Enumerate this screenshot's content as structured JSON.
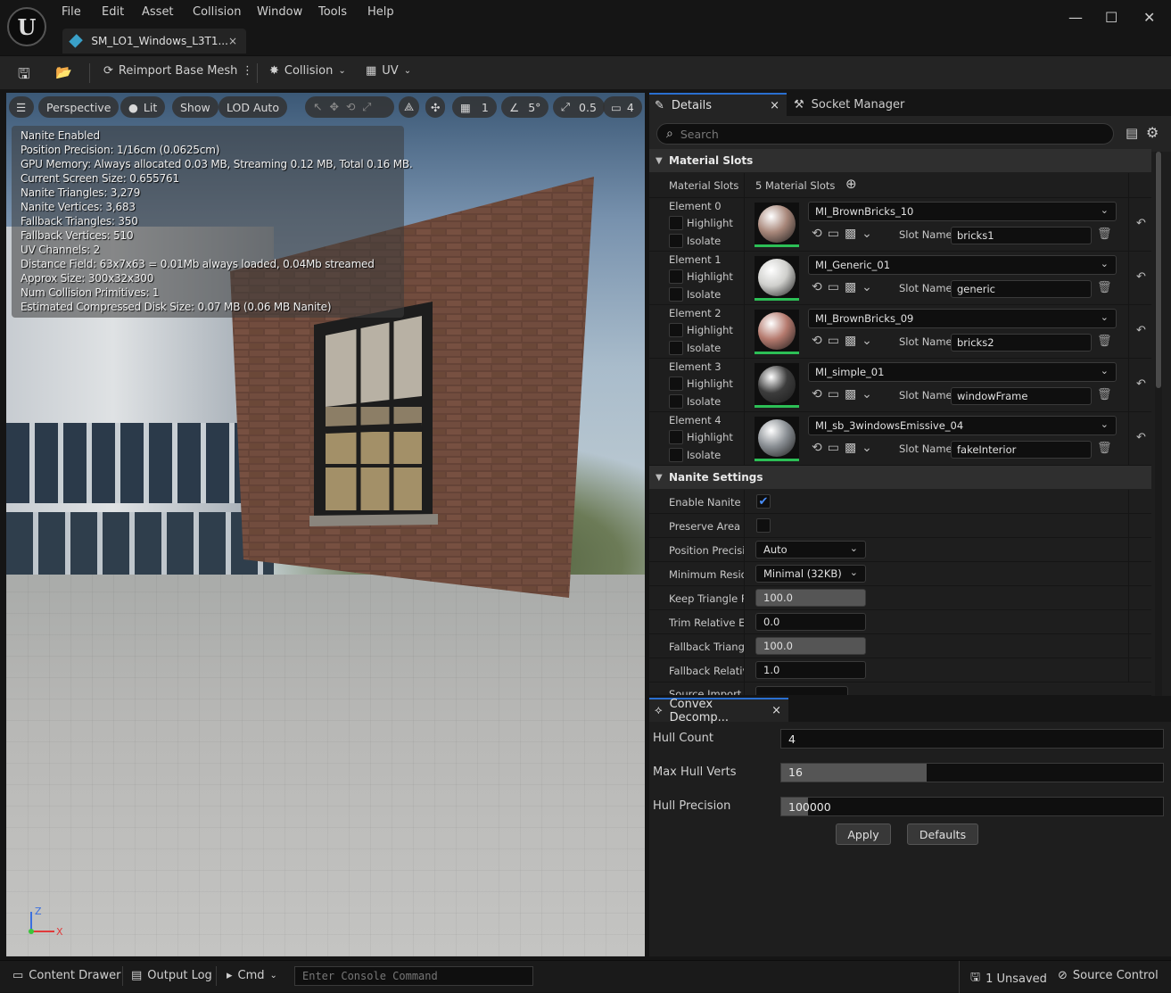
{
  "menu": [
    "File",
    "Edit",
    "Asset",
    "Collision",
    "Window",
    "Tools",
    "Help"
  ],
  "logo_text": "U",
  "tab": {
    "title": "SM_LO1_Windows_L3T1...",
    "close": "×"
  },
  "window_controls": {
    "minimize": "—",
    "maximize": "☐",
    "close": "✕"
  },
  "toolbar": {
    "reimport": "Reimport Base Mesh",
    "collision": "Collision",
    "uv": "UV"
  },
  "viewport": {
    "perspective": "Perspective",
    "lit": "Lit",
    "show": "Show",
    "lod": "LOD Auto",
    "grid_value": "1",
    "angle_value": "5°",
    "scale_value": "0.5",
    "camera_value": "4",
    "stats": [
      "Nanite Enabled",
      "Position Precision: 1/16cm (0.0625cm)",
      "GPU Memory: Always allocated 0.03 MB, Streaming 0.12 MB, Total 0.16 MB.",
      "Current Screen Size: 0.655761",
      "Nanite Triangles: 3,279",
      "Nanite Vertices: 3,683",
      "Fallback Triangles: 350",
      "Fallback Vertices: 510",
      "UV Channels: 2",
      "Distance Field: 63x7x63 = 0.01Mb always loaded, 0.04Mb streamed",
      "Approx Size: 300x32x300",
      "Num Collision Primitives: 1",
      "Estimated Compressed Disk Size: 0.07 MB (0.06 MB Nanite)"
    ],
    "gizmo": {
      "z": "Z",
      "x": "X"
    }
  },
  "details": {
    "tab_label": "Details",
    "tab_close": "×",
    "socket_tab": "Socket Manager",
    "search_placeholder": "Search",
    "material_slots_header": "Material Slots",
    "material_slots_label": "Material Slots",
    "material_slots_count": "5 Material Slots",
    "highlight_label": "Highlight",
    "isolate_label": "Isolate",
    "slot_name_label": "Slot Name",
    "elements": [
      {
        "label": "Element 0",
        "material": "MI_BrownBricks_10",
        "slot": "bricks1",
        "color": "#a8877a"
      },
      {
        "label": "Element 1",
        "material": "MI_Generic_01",
        "slot": "generic",
        "color": "#cfcfcc"
      },
      {
        "label": "Element 2",
        "material": "MI_BrownBricks_09",
        "slot": "bricks2",
        "color": "#b57a6e"
      },
      {
        "label": "Element 3",
        "material": "MI_simple_01",
        "slot": "windowFrame",
        "color": "#3c3c3c"
      },
      {
        "label": "Element 4",
        "material": "MI_sb_3windowsEmissive_04",
        "slot": "fakeInterior",
        "color": "#8a8f94"
      }
    ],
    "nanite_header": "Nanite Settings",
    "nanite": {
      "enable_label": "Enable Nanite Su",
      "enable_checked": true,
      "preserve_label": "Preserve Area",
      "position_label": "Position Precisio",
      "position_value": "Auto",
      "min_res_label": "Minimum Reside",
      "min_res_value": "Minimal (32KB)",
      "keep_tri_label": "Keep Triangle Pe",
      "keep_tri_value": "100.0",
      "trim_label": "Trim Relative Err",
      "trim_value": "0.0",
      "fallback_tri_label": "Fallback Triangle",
      "fallback_tri_value": "100.0",
      "fallback_rel_label": "Fallback Relative",
      "fallback_rel_value": "1.0",
      "source_import_label": "Source Import Fi"
    }
  },
  "convex": {
    "tab_label": "Convex Decomp...",
    "tab_close": "×",
    "hull_count_label": "Hull Count",
    "hull_count": "4",
    "max_verts_label": "Max Hull Verts",
    "max_verts": "16",
    "max_verts_fill": 0.38,
    "precision_label": "Hull Precision",
    "precision": "100000",
    "apply": "Apply",
    "defaults": "Defaults"
  },
  "statusbar": {
    "content_drawer": "Content Drawer",
    "output_log": "Output Log",
    "cmd": "Cmd",
    "console_placeholder": "Enter Console Command",
    "unsaved": "1 Unsaved",
    "source_control": "Source Control"
  }
}
